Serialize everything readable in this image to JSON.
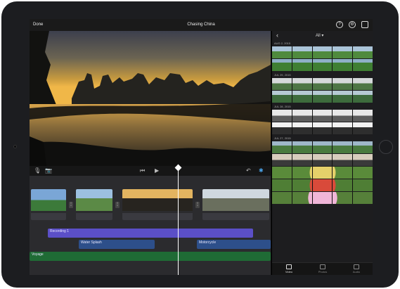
{
  "topbar": {
    "done_label": "Done",
    "project_title": "Chasing China",
    "help_icon_glyph": "?",
    "settings_icon_glyph": "⚙"
  },
  "controls": {
    "skip_back_glyph": "⏮",
    "play_glyph": "▶",
    "undo_glyph": "↶"
  },
  "timeline": {
    "tracks": {
      "recording": "Recording 1",
      "water": "Water Splash",
      "motorcycle": "Motorcycle",
      "voyage": "Voyage"
    },
    "transition_glyph": "⋮",
    "colors": {
      "recording": "#5b4fc7",
      "sfx": "#2d4f8a",
      "music": "#1f6b35"
    }
  },
  "browser": {
    "back_glyph": "‹",
    "filter_label": "All ▾",
    "dates": [
      "AUG 2, 2015",
      "JUL 29, 2015",
      "JUL 28, 2015",
      "JUL 27, 2015"
    ],
    "tabs": [
      "Video",
      "Photos",
      "Audio"
    ]
  }
}
